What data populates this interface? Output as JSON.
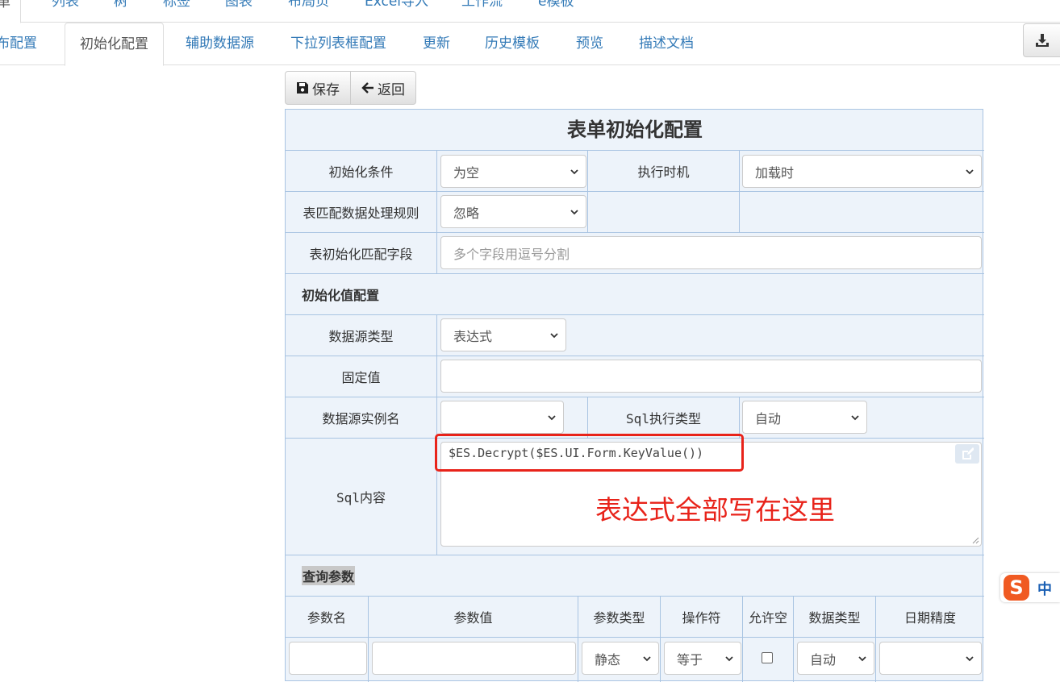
{
  "top_tabs": [
    "表单",
    "列表",
    "树",
    "标签",
    "图表",
    "布局页",
    "Excel导入",
    "工作流",
    "e模板"
  ],
  "sub_tabs": [
    "发布配置",
    "初始化配置",
    "辅助数据源",
    "下拉列表框配置",
    "更新",
    "历史模板",
    "预览",
    "描述文档"
  ],
  "toolbar": {
    "save_label": "保存",
    "back_label": "返回"
  },
  "form": {
    "title": "表单初始化配置",
    "init_condition": {
      "label": "初始化条件",
      "value": "为空"
    },
    "exec_timing": {
      "label": "执行时机",
      "value": "加载时"
    },
    "match_rule": {
      "label": "表匹配数据处理规则",
      "value": "忽略"
    },
    "match_fields": {
      "label": "表初始化匹配字段",
      "placeholder": "多个字段用逗号分割"
    },
    "init_value_section": "初始化值配置",
    "datasource_type": {
      "label": "数据源类型",
      "value": "表达式"
    },
    "fixed_value": {
      "label": "固定值",
      "value": ""
    },
    "datasource_instance": {
      "label": "数据源实例名",
      "value": ""
    },
    "sql_exec_type": {
      "label": "Sql执行类型",
      "value": "自动"
    },
    "sql_content": {
      "label": "Sql内容",
      "value": "$ES.Decrypt($ES.UI.Form.KeyValue())"
    },
    "annotation": "表达式全部写在这里",
    "query_section": "查询参数",
    "param_headers": [
      "参数名",
      "参数值",
      "参数类型",
      "操作符",
      "允许空",
      "数据类型",
      "日期精度"
    ],
    "param_row": {
      "param_type": "静态",
      "operator": "等于",
      "data_type": "自动"
    }
  },
  "ime": {
    "lang": "中"
  },
  "colors": {
    "accent": "#337ab7",
    "annotation": "#e8231a",
    "table_bg": "#edf3fa",
    "border": "#a9c4e2"
  }
}
